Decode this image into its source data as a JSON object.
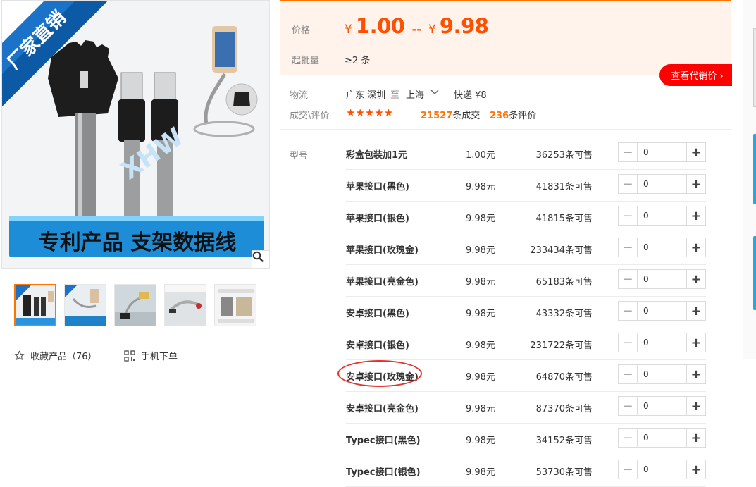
{
  "gallery": {
    "banner_corner_text": "厂家直销",
    "banner_bottom_text": "专利产品 支架数据线",
    "thumbnail_count": 5,
    "active_thumbnail": 0,
    "favorite_label": "收藏产品（76）",
    "mobile_order_label": "手机下单",
    "zoom_icon": "magnifier-icon"
  },
  "price": {
    "label": "价格",
    "currency": "¥",
    "low": "1.00",
    "separator": "--",
    "high": "9.98",
    "moq_label": "起批量",
    "moq_value": "≥2 条"
  },
  "dropship_button": "查看代销价 ›",
  "logistics": {
    "label": "物流",
    "from": "广东 深圳",
    "to_word": "至",
    "to": "上海",
    "express": "快递 ¥8",
    "review_label": "成交\\评价",
    "rating_stars": 5,
    "deals_count": "21527",
    "deals_suffix": "条成交",
    "reviews_count": "236",
    "reviews_suffix": "条评价"
  },
  "sku": {
    "label": "型号",
    "rows": [
      {
        "name": "彩盒包装加1元",
        "price": "1.00元",
        "stock": "36253条可售",
        "qty": "0"
      },
      {
        "name": "苹果接口(黑色)",
        "price": "9.98元",
        "stock": "41831条可售",
        "qty": "0"
      },
      {
        "name": "苹果接口(银色)",
        "price": "9.98元",
        "stock": "41815条可售",
        "qty": "0"
      },
      {
        "name": "苹果接口(玫瑰金)",
        "price": "9.98元",
        "stock": "233434条可售",
        "qty": "0"
      },
      {
        "name": "苹果接口(亮金色)",
        "price": "9.98元",
        "stock": "65183条可售",
        "qty": "0"
      },
      {
        "name": "安卓接口(黑色)",
        "price": "9.98元",
        "stock": "43332条可售",
        "qty": "0"
      },
      {
        "name": "安卓接口(银色)",
        "price": "9.98元",
        "stock": "231722条可售",
        "qty": "0"
      },
      {
        "name": "安卓接口(玫瑰金)",
        "price": "9.98元",
        "stock": "64870条可售",
        "qty": "0"
      },
      {
        "name": "安卓接口(亮金色)",
        "price": "9.98元",
        "stock": "87370条可售",
        "qty": "0"
      },
      {
        "name": "Typec接口(黑色)",
        "price": "9.98元",
        "stock": "34152条可售",
        "qty": "0"
      },
      {
        "name": "Typec接口(银色)",
        "price": "9.98元",
        "stock": "53730条可售",
        "qty": "0"
      }
    ],
    "highlighted_row": 7
  },
  "colors": {
    "accent": "#ff7300",
    "price": "#ff5000",
    "button": "#ff0000",
    "highlight": "#e3322b"
  }
}
